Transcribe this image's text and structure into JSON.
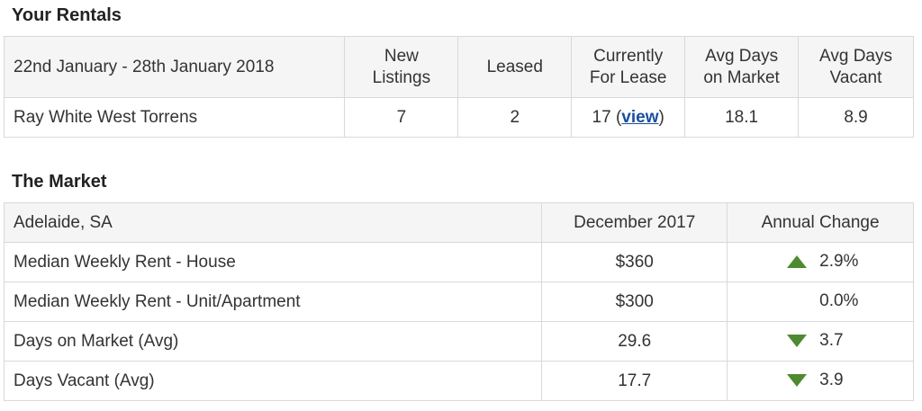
{
  "rentals": {
    "title": "Your Rentals",
    "headers": [
      "22nd January - 28th January 2018",
      "New Listings",
      "Leased",
      "Currently For Lease",
      "Avg Days on Market",
      "Avg Days Vacant"
    ],
    "header_lines": {
      "new_listings": [
        "New",
        "Listings"
      ],
      "currently_for_lease": [
        "Currently",
        "For Lease"
      ],
      "avg_days_market": [
        "Avg Days",
        "on Market"
      ],
      "avg_days_vacant": [
        "Avg Days",
        "Vacant"
      ]
    },
    "row": {
      "office": "Ray White West Torrens",
      "new_listings": "7",
      "leased": "2",
      "for_lease_count": "17",
      "view_label": "view",
      "avg_days_market": "18.1",
      "avg_days_vacant": "8.9"
    }
  },
  "market": {
    "title": "The Market",
    "headers": [
      "Adelaide, SA",
      "December 2017",
      "Annual Change"
    ],
    "rows": [
      {
        "label": "Median Weekly Rent - House",
        "value": "$360",
        "change": "2.9%",
        "trend": "up-arrow-icon"
      },
      {
        "label": "Median Weekly Rent - Unit/Apartment",
        "value": "$300",
        "change": "0.0%",
        "trend": "none"
      },
      {
        "label": "Days on Market (Avg)",
        "value": "29.6",
        "change": "3.7",
        "trend": "down-arrow-icon"
      },
      {
        "label": "Days Vacant (Avg)",
        "value": "17.7",
        "change": "3.9",
        "trend": "down-arrow-icon"
      }
    ]
  },
  "colors": {
    "trend_arrow": "#4e8a2f",
    "link": "#1a4fa0",
    "header_bg": "#f5f5f5",
    "border": "#d9d9d9"
  }
}
